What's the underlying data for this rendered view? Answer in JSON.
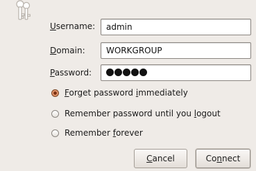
{
  "form": {
    "username": {
      "label_u": "U",
      "label_rest": "sername:",
      "value": "admin"
    },
    "domain": {
      "label_u": "D",
      "label_rest": "omain:",
      "value": "WORKGROUP"
    },
    "password": {
      "label_u": "P",
      "label_rest": "assword:",
      "value_mask_count": 5
    }
  },
  "options": [
    {
      "pre": "",
      "u": "F",
      "post": "orget password ",
      "u2": "i",
      "post2": "mmediately",
      "checked": true
    },
    {
      "pre": "Remember password until you ",
      "u": "l",
      "post": "ogout",
      "u2": "",
      "post2": "",
      "checked": false
    },
    {
      "pre": "Remember ",
      "u": "f",
      "post": "orever",
      "u2": "",
      "post2": "",
      "checked": false
    }
  ],
  "buttons": {
    "cancel": {
      "u": "C",
      "rest": "ancel"
    },
    "connect": {
      "pre": "Co",
      "u": "n",
      "rest": "nect"
    }
  },
  "icons": {
    "dialog_icon": "keys-icon"
  },
  "colors": {
    "background": "#efebe7",
    "radio_selected": "#cc6a3c"
  }
}
